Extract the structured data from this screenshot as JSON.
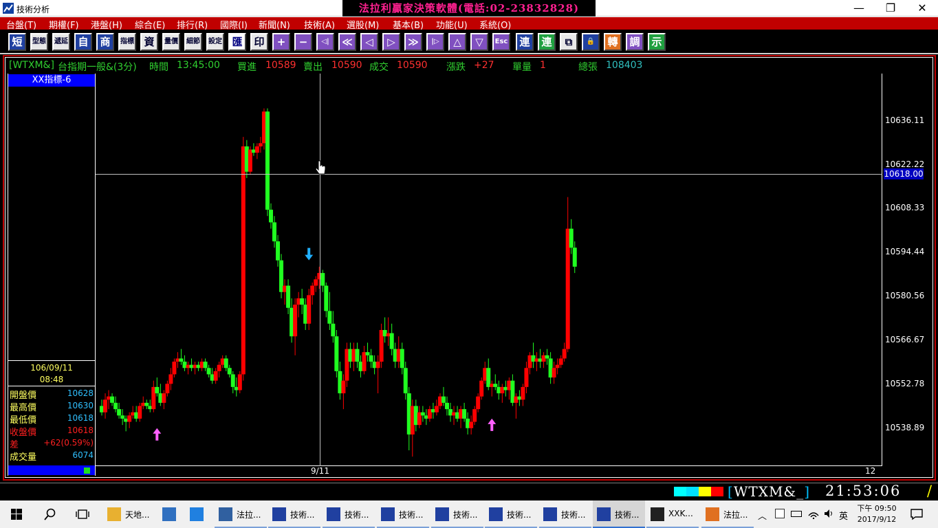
{
  "window": {
    "title": "技術分析",
    "banner": "法拉利贏家決策軟體(電話:02-23832828)",
    "buttons": [
      "—",
      "❐",
      "✕"
    ]
  },
  "menu": [
    "台盤(T)",
    "期權(F)",
    "港盤(H)",
    "綜合(E)",
    "排行(R)",
    "國際(I)",
    "新聞(N)",
    "技術(A)",
    "選股(M)",
    "基本(B)",
    "功能(U)",
    "系統(O)"
  ],
  "toolbar": [
    "短",
    "型態",
    "遞延",
    "自",
    "商",
    "指標",
    "資",
    "量價",
    "細節",
    "設定",
    "匯",
    "印",
    "+",
    "−",
    "◁|",
    "≪",
    "◁",
    "▷",
    "≫",
    "|▷",
    "△",
    "▽",
    "Esc",
    "連",
    "連",
    "⧉",
    "🔒",
    "轉",
    "調",
    "示"
  ],
  "quote": {
    "symbol": "[WTXM&]",
    "name": "台指期一般&(3分)",
    "time_label": "時間",
    "time": "13:45:00",
    "bid_label": "買進",
    "bid": "10589",
    "ask_label": "賣出",
    "ask": "10590",
    "last_label": "成交",
    "last": "10590",
    "change_label": "漲跌",
    "change": "+27",
    "vol_label": "單量",
    "vol": "1",
    "total_label": "總張",
    "total": "108403"
  },
  "indicator_label": "XX指標-6",
  "panel": {
    "date": "106/09/11",
    "time": "08:48",
    "rows": [
      {
        "k": "開盤價",
        "v": "10628",
        "kc": "#ffff60",
        "vc": "#30c0ff"
      },
      {
        "k": "最高價",
        "v": "10630",
        "kc": "#ffff60",
        "vc": "#30c0ff"
      },
      {
        "k": "最低價",
        "v": "10618",
        "kc": "#ffff60",
        "vc": "#30c0ff"
      },
      {
        "k": "收盤價",
        "v": "10618",
        "kc": "#ff2020",
        "vc": "#ff2020"
      },
      {
        "k": "差",
        "v": "+62(0.59%)",
        "kc": "#ff2020",
        "vc": "#ff2020"
      },
      {
        "k": "成交量",
        "v": "6074",
        "kc": "#ffff60",
        "vc": "#30c0ff"
      }
    ]
  },
  "chart_data": {
    "type": "candlestick",
    "y_ticks": [
      "10636.11",
      "10622.22",
      "10608.33",
      "10594.44",
      "10580.56",
      "10566.67",
      "10552.78",
      "10538.89"
    ],
    "y_range": [
      10527,
      10651
    ],
    "cursor_value": "10618.00",
    "x_labels": [
      "9/11",
      "12"
    ],
    "up_color": "#ff0000",
    "down_color": "#20ff20",
    "candles": [
      [
        10546,
        10548,
        10543,
        10544
      ],
      [
        10544,
        10550,
        10542,
        10548
      ],
      [
        10548,
        10551,
        10545,
        10549
      ],
      [
        10549,
        10550,
        10546,
        10547
      ],
      [
        10547,
        10549,
        10544,
        10545
      ],
      [
        10545,
        10547,
        10542,
        10543
      ],
      [
        10543,
        10545,
        10540,
        10542
      ],
      [
        10542,
        10543,
        10538,
        10541
      ],
      [
        10541,
        10544,
        10539,
        10543
      ],
      [
        10543,
        10546,
        10542,
        10544
      ],
      [
        10544,
        10546,
        10541,
        10542
      ],
      [
        10542,
        10547,
        10541,
        10546
      ],
      [
        10546,
        10549,
        10545,
        10547
      ],
      [
        10547,
        10548,
        10545,
        10546
      ],
      [
        10546,
        10548,
        10544,
        10545
      ],
      [
        10545,
        10554,
        10544,
        10552
      ],
      [
        10552,
        10555,
        10549,
        10550
      ],
      [
        10550,
        10553,
        10546,
        10547
      ],
      [
        10547,
        10551,
        10545,
        10550
      ],
      [
        10550,
        10554,
        10549,
        10553
      ],
      [
        10553,
        10558,
        10551,
        10556
      ],
      [
        10556,
        10561,
        10555,
        10560
      ],
      [
        10560,
        10563,
        10558,
        10561
      ],
      [
        10561,
        10564,
        10559,
        10560
      ],
      [
        10560,
        10562,
        10557,
        10558
      ],
      [
        10558,
        10560,
        10556,
        10559
      ],
      [
        10559,
        10561,
        10557,
        10558
      ],
      [
        10558,
        10560,
        10556,
        10559
      ],
      [
        10559,
        10560,
        10557,
        10558
      ],
      [
        10558,
        10561,
        10557,
        10560
      ],
      [
        10560,
        10561,
        10557,
        10558
      ],
      [
        10558,
        10559,
        10555,
        10556
      ],
      [
        10556,
        10558,
        10553,
        10554
      ],
      [
        10554,
        10558,
        10553,
        10557
      ],
      [
        10557,
        10560,
        10555,
        10559
      ],
      [
        10559,
        10562,
        10558,
        10561
      ],
      [
        10561,
        10562,
        10557,
        10558
      ],
      [
        10558,
        10559,
        10555,
        10556
      ],
      [
        10556,
        10557,
        10550,
        10552
      ],
      [
        10552,
        10555,
        10549,
        10551
      ],
      [
        10551,
        10557,
        10550,
        10556
      ],
      [
        10556,
        10631,
        10554,
        10628
      ],
      [
        10628,
        10630,
        10618,
        10620
      ],
      [
        10620,
        10628,
        10619,
        10627
      ],
      [
        10627,
        10629,
        10625,
        10626
      ],
      [
        10626,
        10629,
        10624,
        10628
      ],
      [
        10628,
        10631,
        10626,
        10629
      ],
      [
        10629,
        10640,
        10627,
        10639
      ],
      [
        10639,
        10640,
        10606,
        10608
      ],
      [
        10608,
        10610,
        10602,
        10604
      ],
      [
        10604,
        10606,
        10596,
        10598
      ],
      [
        10598,
        10600,
        10590,
        10592
      ],
      [
        10592,
        10594,
        10580,
        10582
      ],
      [
        10582,
        10586,
        10578,
        10584
      ],
      [
        10584,
        10586,
        10575,
        10577
      ],
      [
        10577,
        10580,
        10566,
        10568
      ],
      [
        10568,
        10580,
        10562,
        10578
      ],
      [
        10578,
        10582,
        10574,
        10580
      ],
      [
        10580,
        10583,
        10575,
        10578
      ],
      [
        10578,
        10580,
        10570,
        10572
      ],
      [
        10572,
        10583,
        10570,
        10581
      ],
      [
        10581,
        10585,
        10578,
        10584
      ],
      [
        10584,
        10587,
        10582,
        10586
      ],
      [
        10586,
        10590,
        10583,
        10588
      ],
      [
        10588,
        10589,
        10582,
        10584
      ],
      [
        10584,
        10585,
        10574,
        10576
      ],
      [
        10576,
        10582,
        10570,
        10572
      ],
      [
        10572,
        10576,
        10566,
        10568
      ],
      [
        10568,
        10570,
        10555,
        10557
      ],
      [
        10557,
        10560,
        10548,
        10550
      ],
      [
        10550,
        10556,
        10545,
        10554
      ],
      [
        10554,
        10566,
        10552,
        10564
      ],
      [
        10564,
        10566,
        10558,
        10560
      ],
      [
        10560,
        10566,
        10557,
        10564
      ],
      [
        10564,
        10566,
        10558,
        10560
      ],
      [
        10560,
        10562,
        10555,
        10557
      ],
      [
        10557,
        10565,
        10556,
        10563
      ],
      [
        10563,
        10566,
        10560,
        10562
      ],
      [
        10562,
        10564,
        10558,
        10560
      ],
      [
        10560,
        10562,
        10556,
        10558
      ],
      [
        10558,
        10562,
        10550,
        10560
      ],
      [
        10560,
        10572,
        10558,
        10570
      ],
      [
        10570,
        10574,
        10566,
        10568
      ],
      [
        10568,
        10574,
        10565,
        10569
      ],
      [
        10569,
        10572,
        10562,
        10564
      ],
      [
        10564,
        10566,
        10558,
        10560
      ],
      [
        10560,
        10568,
        10558,
        10564
      ],
      [
        10564,
        10566,
        10556,
        10558
      ],
      [
        10558,
        10560,
        10548,
        10550
      ],
      [
        10550,
        10552,
        10532,
        10537
      ],
      [
        10537,
        10548,
        10530,
        10546
      ],
      [
        10546,
        10548,
        10538,
        10540
      ],
      [
        10540,
        10546,
        10539,
        10544
      ],
      [
        10544,
        10546,
        10541,
        10543
      ],
      [
        10543,
        10545,
        10540,
        10542
      ],
      [
        10542,
        10546,
        10541,
        10545
      ],
      [
        10545,
        10547,
        10542,
        10544
      ],
      [
        10544,
        10548,
        10543,
        10546
      ],
      [
        10546,
        10550,
        10545,
        10549
      ],
      [
        10549,
        10552,
        10546,
        10547
      ],
      [
        10547,
        10549,
        10543,
        10545
      ],
      [
        10545,
        10547,
        10541,
        10543
      ],
      [
        10543,
        10546,
        10540,
        10544
      ],
      [
        10544,
        10546,
        10541,
        10542
      ],
      [
        10542,
        10546,
        10539,
        10545
      ],
      [
        10545,
        10547,
        10541,
        10542
      ],
      [
        10542,
        10544,
        10537,
        10539
      ],
      [
        10539,
        10543,
        10537,
        10541
      ],
      [
        10541,
        10546,
        10540,
        10545
      ],
      [
        10545,
        10550,
        10544,
        10549
      ],
      [
        10549,
        10555,
        10548,
        10554
      ],
      [
        10554,
        10560,
        10553,
        10558
      ],
      [
        10558,
        10561,
        10551,
        10552
      ],
      [
        10552,
        10554,
        10549,
        10553
      ],
      [
        10553,
        10556,
        10551,
        10552
      ],
      [
        10552,
        10554,
        10548,
        10550
      ],
      [
        10550,
        10553,
        10547,
        10552
      ],
      [
        10552,
        10554,
        10549,
        10551
      ],
      [
        10551,
        10555,
        10548,
        10554
      ],
      [
        10554,
        10556,
        10546,
        10547
      ],
      [
        10547,
        10550,
        10542,
        10549
      ],
      [
        10549,
        10551,
        10546,
        10548
      ],
      [
        10548,
        10553,
        10546,
        10552
      ],
      [
        10552,
        10560,
        10550,
        10558
      ],
      [
        10558,
        10563,
        10556,
        10562
      ],
      [
        10562,
        10566,
        10558,
        10560
      ],
      [
        10560,
        10563,
        10557,
        10561
      ],
      [
        10561,
        10564,
        10558,
        10560
      ],
      [
        10560,
        10563,
        10558,
        10562
      ],
      [
        10562,
        10564,
        10559,
        10561
      ],
      [
        10561,
        10563,
        10553,
        10555
      ],
      [
        10555,
        10560,
        10553,
        10558
      ],
      [
        10558,
        10561,
        10556,
        10559
      ],
      [
        10559,
        10562,
        10558,
        10561
      ],
      [
        10561,
        10566,
        10560,
        10564
      ],
      [
        10564,
        10612,
        10563,
        10602
      ],
      [
        10602,
        10605,
        10594,
        10596
      ],
      [
        10596,
        10598,
        10588,
        10590
      ]
    ],
    "signals": [
      {
        "index": 16,
        "dir": "up",
        "price": 10539
      },
      {
        "index": 60,
        "dir": "down",
        "price": 10592
      },
      {
        "index": 113,
        "dir": "up",
        "price": 10542
      }
    ]
  },
  "status": {
    "symbol": "WTXM&_",
    "clock": "21:53:06",
    "colors": [
      "#00ffff",
      "#00e0ff",
      "#ffff00",
      "#ff0000"
    ]
  },
  "taskbar": {
    "items": [
      {
        "label": "天地...",
        "icon": "folder-icon",
        "color": "#e8b030"
      },
      {
        "label": "",
        "icon": "computer-icon",
        "color": "#3070c0"
      },
      {
        "label": "",
        "icon": "ie-icon",
        "color": "#2080e0"
      },
      {
        "label": "法拉...",
        "icon": "app-icon",
        "color": "#3060a0"
      },
      {
        "label": "技術...",
        "icon": "chart-icon",
        "color": "#2040a0"
      },
      {
        "label": "技術...",
        "icon": "chart-icon",
        "color": "#2040a0"
      },
      {
        "label": "技術...",
        "icon": "chart-icon",
        "color": "#2040a0"
      },
      {
        "label": "技術...",
        "icon": "chart-icon",
        "color": "#2040a0"
      },
      {
        "label": "技術...",
        "icon": "chart-icon",
        "color": "#2040a0"
      },
      {
        "label": "技術...",
        "icon": "chart-icon",
        "color": "#2040a0"
      },
      {
        "label": "技術...",
        "icon": "chart-icon",
        "color": "#2040a0"
      },
      {
        "label": "XXK...",
        "icon": "image-icon",
        "color": "#202020"
      },
      {
        "label": "法拉...",
        "icon": "app-icon",
        "color": "#e07020"
      }
    ],
    "ime": "英",
    "time": "下午 09:50",
    "date": "2017/9/12"
  }
}
